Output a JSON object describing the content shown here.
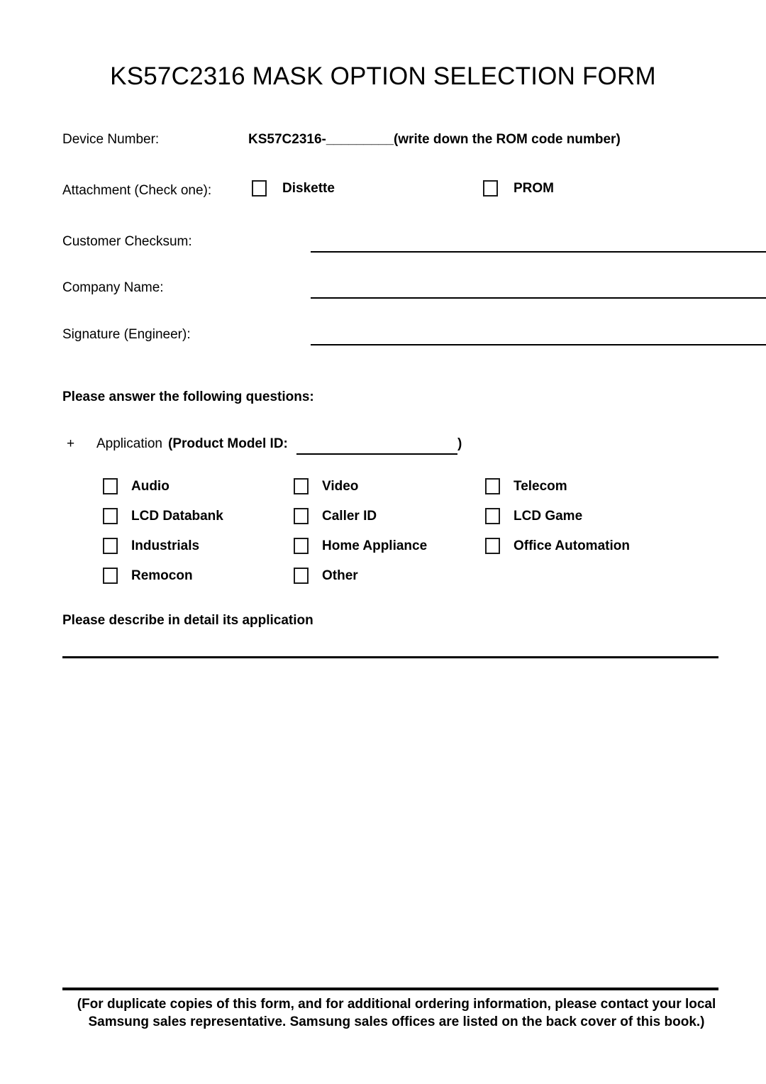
{
  "document": {
    "title": "KS57C2316 MASK OPTION SELECTION FORM"
  },
  "fields": {
    "device_number": {
      "label": "Device Number:",
      "value": "KS57C2316-_________(write down the ROM code number)"
    },
    "attachment": {
      "label": "Attachment (Check one):",
      "options": [
        {
          "label": "Diskette",
          "checked": false
        },
        {
          "label": "PROM",
          "checked": false
        }
      ]
    },
    "customer_checksum": {
      "label": "Customer Checksum:",
      "value": ""
    },
    "company_name": {
      "label": "Company Name:",
      "value": ""
    },
    "signature_engineer": {
      "label": "Signature (Engineer):",
      "value": ""
    }
  },
  "questions": {
    "heading": "Please answer the following questions:",
    "application": {
      "bullet": "+",
      "label": "Application",
      "model_id_label": "(Product Model ID:",
      "model_id_value": "",
      "closing_paren": ")"
    },
    "application_options": [
      [
        {
          "label": "Audio",
          "checked": false
        },
        {
          "label": "Video",
          "checked": false
        },
        {
          "label": "Telecom",
          "checked": false
        }
      ],
      [
        {
          "label": "LCD Databank",
          "checked": false
        },
        {
          "label": "Caller ID",
          "checked": false
        },
        {
          "label": "LCD Game",
          "checked": false
        }
      ],
      [
        {
          "label": "Industrials",
          "checked": false
        },
        {
          "label": "Home Appliance",
          "checked": false
        },
        {
          "label": "Office Automation",
          "checked": false
        }
      ],
      [
        {
          "label": "Remocon",
          "checked": false
        },
        {
          "label": "Other",
          "checked": false
        },
        {
          "label": "",
          "checked": false
        }
      ]
    ],
    "describe_heading": "Please describe in detail its application",
    "describe_value": ""
  },
  "footer": {
    "line1": "(For duplicate copies of this form, and for additional ordering information, please contact your local",
    "line2": "Samsung sales representative. Samsung sales offices are listed on the back cover of this book.)"
  }
}
